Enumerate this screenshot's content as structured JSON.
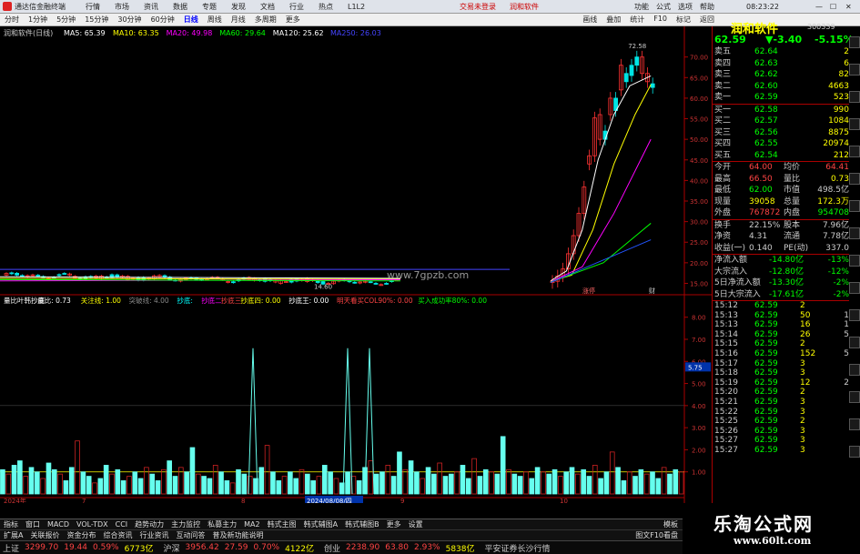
{
  "window": {
    "title": "通达信金融终端",
    "menu": [
      "行情",
      "市场",
      "资讯",
      "数据",
      "专题",
      "发现",
      "文档",
      "行业",
      "热点",
      "L1L2"
    ],
    "top_links": [
      "交易未登录",
      "润和软件"
    ],
    "right_menu": [
      "功能",
      "公式",
      "选项",
      "帮助"
    ],
    "time": "08:23:22"
  },
  "toolbar": {
    "periods": [
      "分时",
      "1分钟",
      "5分钟",
      "15分钟",
      "30分钟",
      "60分钟",
      "日线",
      "周线",
      "月线",
      "多周期",
      "更多"
    ],
    "right_tools": [
      "F10",
      "标记",
      "返回"
    ],
    "right_icons": [
      "画线",
      "叠加",
      "统计"
    ]
  },
  "chart_header": {
    "name": "润和软件(日线)",
    "ma": [
      {
        "label": "MA5: 65.39",
        "color": "#ffffff"
      },
      {
        "label": "MA10: 63.35",
        "color": "#ffff00"
      },
      {
        "label": "MA20: 49.98",
        "color": "#ff00ff"
      },
      {
        "label": "MA60: 29.64",
        "color": "#00ff00"
      },
      {
        "label": "MA120: 25.62",
        "color": "#ffffff"
      }
    ],
    "ma250": "MA250: 26.03"
  },
  "price_axis": [
    "70.00",
    "65.00",
    "60.00",
    "55.00",
    "50.00",
    "45.00",
    "40.00",
    "35.00",
    "30.00",
    "25.00",
    "20.00",
    "15.00"
  ],
  "annotations": {
    "high": "72.58",
    "low": "14.60",
    "watermark_site": "www.7gpzb.com",
    "tag1": "涨停",
    "tag2": "财"
  },
  "indicator_header": [
    {
      "label": "量比叶韩抄底",
      "color": "#ffffff"
    },
    {
      "label": "量比: 0.73",
      "color": "#ffffff"
    },
    {
      "label": "关注线: 1.00",
      "color": "#ffff00"
    },
    {
      "label": "突破线: 4.00",
      "color": "#888888"
    },
    {
      "label": "抄底: ",
      "color": "#00ffff"
    },
    {
      "label": "抄底二",
      "color": "#ff00ff"
    },
    {
      "label": "抄底三",
      "color": "#ff4444"
    },
    {
      "label": "抄底四: 0.00",
      "color": "#ffff00"
    },
    {
      "label": "抄底王: 0.00",
      "color": "#ffffff"
    },
    {
      "label": "明天看买COL90%: 0.00",
      "color": "#ff4444"
    },
    {
      "label": "买入成功率80%: 0.00",
      "color": "#00ff00"
    }
  ],
  "indicator_axis": [
    "8.00",
    "7.00",
    "6.00",
    "5.75",
    "5.00",
    "4.00",
    "3.00",
    "2.00",
    "1.00"
  ],
  "date_axis": {
    "left": "2024年",
    "mid": "2024/08/08/四",
    "marks": [
      "7",
      "8",
      "9",
      "10"
    ]
  },
  "stock": {
    "name": "润和软件",
    "code": "300339",
    "price": "62.59",
    "change": "-3.40",
    "pct": "-5.15%",
    "asks": [
      {
        "label": "卖五",
        "price": "62.64",
        "vol": "2"
      },
      {
        "label": "卖四",
        "price": "62.63",
        "vol": "6"
      },
      {
        "label": "卖三",
        "price": "62.62",
        "vol": "82"
      },
      {
        "label": "卖二",
        "price": "62.60",
        "vol": "4663"
      },
      {
        "label": "卖一",
        "price": "62.59",
        "vol": "523"
      }
    ],
    "bids": [
      {
        "label": "买一",
        "price": "62.58",
        "vol": "990"
      },
      {
        "label": "买二",
        "price": "62.57",
        "vol": "1084"
      },
      {
        "label": "买三",
        "price": "62.56",
        "vol": "8875"
      },
      {
        "label": "买四",
        "price": "62.55",
        "vol": "20974"
      },
      {
        "label": "买五",
        "price": "62.54",
        "vol": "212"
      }
    ],
    "stats": [
      {
        "k1": "今开",
        "v1": "64.00",
        "k2": "均价",
        "v2": "64.41"
      },
      {
        "k1": "最高",
        "v1": "66.50",
        "k2": "量比",
        "v2": "0.73"
      },
      {
        "k1": "最低",
        "v1": "62.00",
        "k2": "市值",
        "v2": "498.5亿"
      },
      {
        "k1": "现量",
        "v1": "39058",
        "k2": "总量",
        "v2": "172.3万"
      },
      {
        "k1": "外盘",
        "v1": "767872",
        "k2": "内盘",
        "v2": "954708"
      }
    ],
    "stats2": [
      {
        "k1": "换手",
        "v1": "22.15%",
        "k2": "股本",
        "v2": "7.96亿"
      },
      {
        "k1": "净资",
        "v1": "4.31",
        "k2": "流通",
        "v2": "7.78亿"
      },
      {
        "k1": "收益(一)",
        "v1": "0.140",
        "k2": "PE(动)",
        "v2": "337.0"
      }
    ],
    "flows": [
      {
        "label": "净流入额",
        "val": "-14.80亿",
        "pct": "-13%"
      },
      {
        "label": "大宗流入",
        "val": "-12.80亿",
        "pct": "-12%"
      },
      {
        "label": "5日净流入额",
        "val": "-13.30亿",
        "pct": "-2%"
      },
      {
        "label": "5日大宗流入",
        "val": "-17.61亿",
        "pct": "-2%"
      }
    ],
    "ticks": [
      {
        "t": "15:12",
        "p": "62.59",
        "v": "2"
      },
      {
        "t": "15:13",
        "p": "62.59",
        "v": "50",
        "f": "1"
      },
      {
        "t": "15:13",
        "p": "62.59",
        "v": "16",
        "f": "1"
      },
      {
        "t": "15:14",
        "p": "62.59",
        "v": "26",
        "f": "5"
      },
      {
        "t": "15:15",
        "p": "62.59",
        "v": "2"
      },
      {
        "t": "15:16",
        "p": "62.59",
        "v": "152",
        "f": "5"
      },
      {
        "t": "15:17",
        "p": "62.59",
        "v": "3"
      },
      {
        "t": "15:18",
        "p": "62.59",
        "v": "3"
      },
      {
        "t": "15:19",
        "p": "62.59",
        "v": "12",
        "f": "2"
      },
      {
        "t": "15:20",
        "p": "62.59",
        "v": "2"
      },
      {
        "t": "15:21",
        "p": "62.59",
        "v": "3"
      },
      {
        "t": "15:22",
        "p": "62.59",
        "v": "3"
      },
      {
        "t": "15:25",
        "p": "62.59",
        "v": "2"
      },
      {
        "t": "15:26",
        "p": "62.59",
        "v": "3"
      },
      {
        "t": "15:27",
        "p": "62.59",
        "v": "3"
      },
      {
        "t": "15:27",
        "p": "62.59",
        "v": "3"
      }
    ]
  },
  "bottom_tabs": [
    "指标",
    "窗口",
    "MACD",
    "VOL-TDX",
    "CCI",
    "趋势动力",
    "主力监控",
    "私募主力",
    "MA2",
    "韩式主图",
    "韩式辅图A",
    "韩式辅图B",
    "更多",
    "设置"
  ],
  "bottom_tabs2": [
    "扩展A",
    "关联报价",
    "资金分布",
    "综合资讯",
    "行业资讯",
    "互动问答",
    "普及新功能说明"
  ],
  "bottom_right": [
    "模板",
    "图文F10看盘"
  ],
  "index_bar": [
    {
      "name": "上证",
      "val": "3299.70",
      "chg": "19.44",
      "pct": "0.59%",
      "amt": "6773亿"
    },
    {
      "name": "沪深",
      "val": "3956.42",
      "chg": "27.59",
      "pct": "0.70%",
      "amt": "4122亿"
    },
    {
      "name": "创业",
      "val": "2238.90",
      "chg": "63.80",
      "pct": "2.93%",
      "amt": "5838亿"
    }
  ],
  "broker": "平安证券长沙行情",
  "brand_watermark": {
    "cn": "乐淘公式网",
    "url": "www.60lt.com"
  }
}
